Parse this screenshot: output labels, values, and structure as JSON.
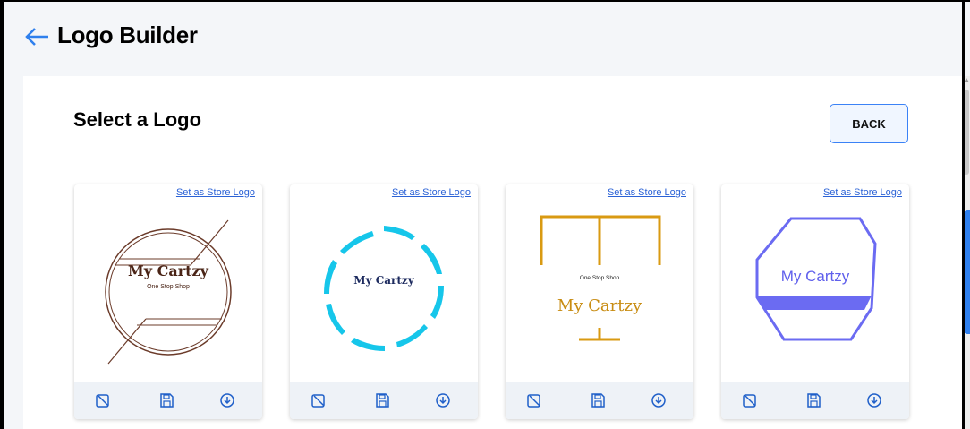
{
  "header": {
    "title": "Logo Builder",
    "back_icon": "arrow-left-icon"
  },
  "section": {
    "title": "Select a Logo",
    "back_button_label": "BACK"
  },
  "colors": {
    "link": "#2b62d6",
    "accent": "#2f80ed",
    "card_footer": "#eef2f7"
  },
  "cards": [
    {
      "link_label": "Set as Store Logo",
      "logo_text": "My Cartzy",
      "logo_subtext": "One Stop Shop",
      "actions": [
        "edit-icon",
        "save-icon",
        "download-icon"
      ]
    },
    {
      "link_label": "Set as Store Logo",
      "logo_text": "My Cartzy",
      "actions": [
        "edit-icon",
        "save-icon",
        "download-icon"
      ]
    },
    {
      "link_label": "Set as Store Logo",
      "logo_text": "My Cartzy",
      "logo_subtext": "One Stop Shop",
      "actions": [
        "edit-icon",
        "save-icon",
        "download-icon"
      ]
    },
    {
      "link_label": "Set as Store Logo",
      "logo_text": "My Cartzy",
      "actions": [
        "edit-icon",
        "save-icon",
        "download-icon"
      ]
    }
  ]
}
